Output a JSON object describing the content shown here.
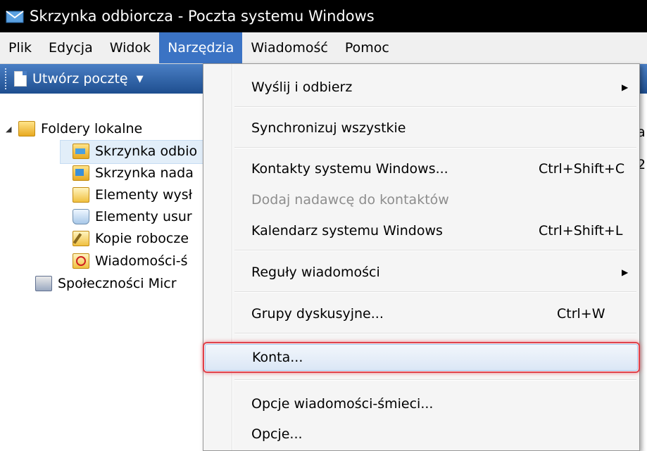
{
  "window": {
    "title": "Skrzynka odbiorcza - Poczta systemu Windows",
    "icon": "mail-app-icon"
  },
  "menubar": {
    "items": [
      {
        "label": "Plik"
      },
      {
        "label": "Edycja"
      },
      {
        "label": "Widok"
      },
      {
        "label": "Narzędzia",
        "active": true
      },
      {
        "label": "Wiadomość"
      },
      {
        "label": "Pomoc"
      }
    ]
  },
  "toolbar": {
    "compose_label": "Utwórz pocztę"
  },
  "folders": {
    "root": "Foldery lokalne",
    "items": [
      {
        "label": "Skrzynka odbio",
        "icon": "inbox-icon"
      },
      {
        "label": "Skrzynka nada",
        "icon": "outbox-icon"
      },
      {
        "label": "Elementy wysł",
        "icon": "sent-items-icon"
      },
      {
        "label": "Elementy usur",
        "icon": "deleted-items-icon"
      },
      {
        "label": "Kopie robocze",
        "icon": "drafts-icon"
      },
      {
        "label": "Wiadomości-ś",
        "icon": "junk-mail-icon"
      }
    ],
    "community": "Społeczności Micr"
  },
  "right_stub": {
    "line1": "a",
    "line2": "2."
  },
  "tools_menu": {
    "items": [
      {
        "label": "Wyślij i odbierz",
        "shortcut": "",
        "submenu": true,
        "disabled": false
      },
      {
        "label": "Synchronizuj wszystkie",
        "shortcut": "",
        "submenu": false,
        "disabled": false
      },
      {
        "label": "Kontakty systemu Windows...",
        "shortcut": "Ctrl+Shift+C",
        "submenu": false,
        "disabled": false
      },
      {
        "label": "Dodaj nadawcę do kontaktów",
        "shortcut": "",
        "submenu": false,
        "disabled": true
      },
      {
        "label": "Kalendarz systemu Windows",
        "shortcut": "Ctrl+Shift+L",
        "submenu": false,
        "disabled": false
      },
      {
        "label": "Reguły wiadomości",
        "shortcut": "",
        "submenu": true,
        "disabled": false
      },
      {
        "label": "Grupy dyskusyjne...",
        "shortcut": "Ctrl+W",
        "submenu": false,
        "disabled": false
      },
      {
        "label": "Konta...",
        "shortcut": "",
        "submenu": false,
        "disabled": false,
        "highlighted": true
      },
      {
        "label": "Opcje wiadomości-śmieci...",
        "shortcut": "",
        "submenu": false,
        "disabled": false
      },
      {
        "label": "Opcje...",
        "shortcut": "",
        "submenu": false,
        "disabled": false
      }
    ],
    "submenu_glyph": "▶"
  },
  "colors": {
    "titlebar": "#000000",
    "menu_active": "#3b73c4",
    "toolbar": "#2a5fa6",
    "highlight_outline": "#e0404a"
  }
}
